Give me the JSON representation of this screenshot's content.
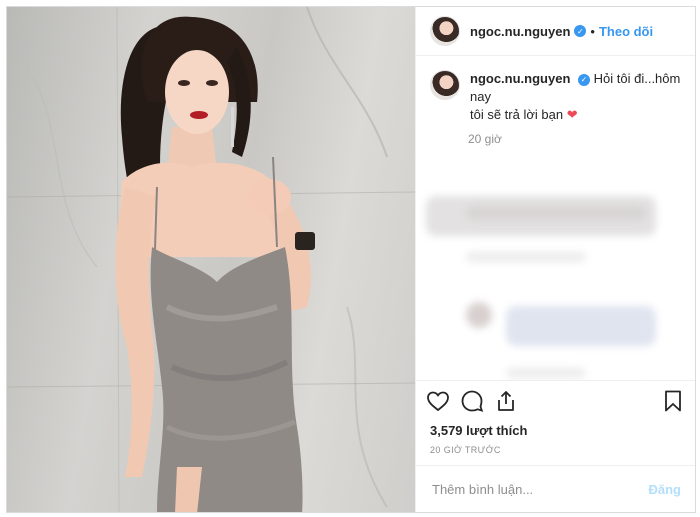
{
  "post": {
    "username": "ngoc.nu.nguyen",
    "follow_label": "Theo dõi",
    "separator": "•",
    "verified_glyph": "✓",
    "caption_line1": "Hỏi tôi đi...hôm nay",
    "caption_line2": "tôi sẽ trả lời bạn",
    "caption_emoji": "❤",
    "caption_time": "20 giờ",
    "likes": "3,579 lượt thích",
    "time_ago": "20 GIỜ TRƯỚC",
    "comment_placeholder": "Thêm bình luận...",
    "post_label": "Đăng"
  },
  "icons": {
    "like": "heart-outline-icon",
    "comment": "comment-bubble-icon",
    "share": "share-icon",
    "save": "bookmark-icon"
  },
  "colors": {
    "accent": "#3897f0",
    "heart": "#ed4956",
    "muted": "#8e8e8e",
    "post_disabled": "#b2dffc"
  }
}
